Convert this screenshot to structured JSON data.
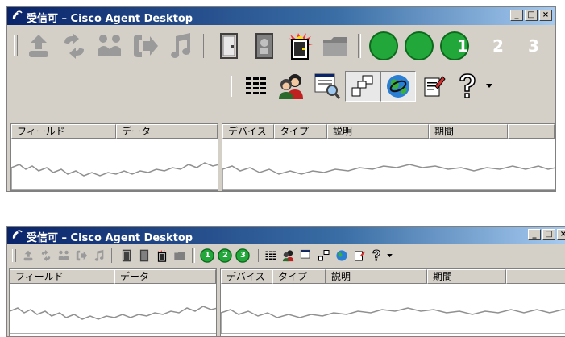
{
  "window_title": "受信可 – Cisco Agent Desktop",
  "caption_buttons": {
    "minimize": "_",
    "maximize": "□",
    "close": "×"
  },
  "toolbar": {
    "call_control_icons": [
      "answer-icon",
      "hold-icon",
      "conference-icon",
      "transfer-icon",
      "touchtone-icon"
    ],
    "agent_state_icons": [
      "logout-icon",
      "not-ready-icon",
      "ready-icon",
      "work-icon"
    ],
    "task_buttons": [
      "1",
      "2",
      "3"
    ],
    "tool_icons": [
      "call-activity-grid-icon",
      "chat-icon",
      "report-search-icon",
      "layout-icon",
      "web-browser-icon",
      "notes-icon",
      "help-icon",
      "dropdown-arrow-icon"
    ]
  },
  "enterprise_data": {
    "columns": [
      "フィールド",
      "データ"
    ]
  },
  "call_activity": {
    "columns": [
      "デバイス",
      "タイプ",
      "説明",
      "期間"
    ]
  },
  "colors": {
    "title_gradient_start": "#0a246a",
    "title_gradient_end": "#a6caf0",
    "task_green": "#22a83a",
    "disabled_gray": "#9a9a9a",
    "panel": "#d4d0c8"
  }
}
